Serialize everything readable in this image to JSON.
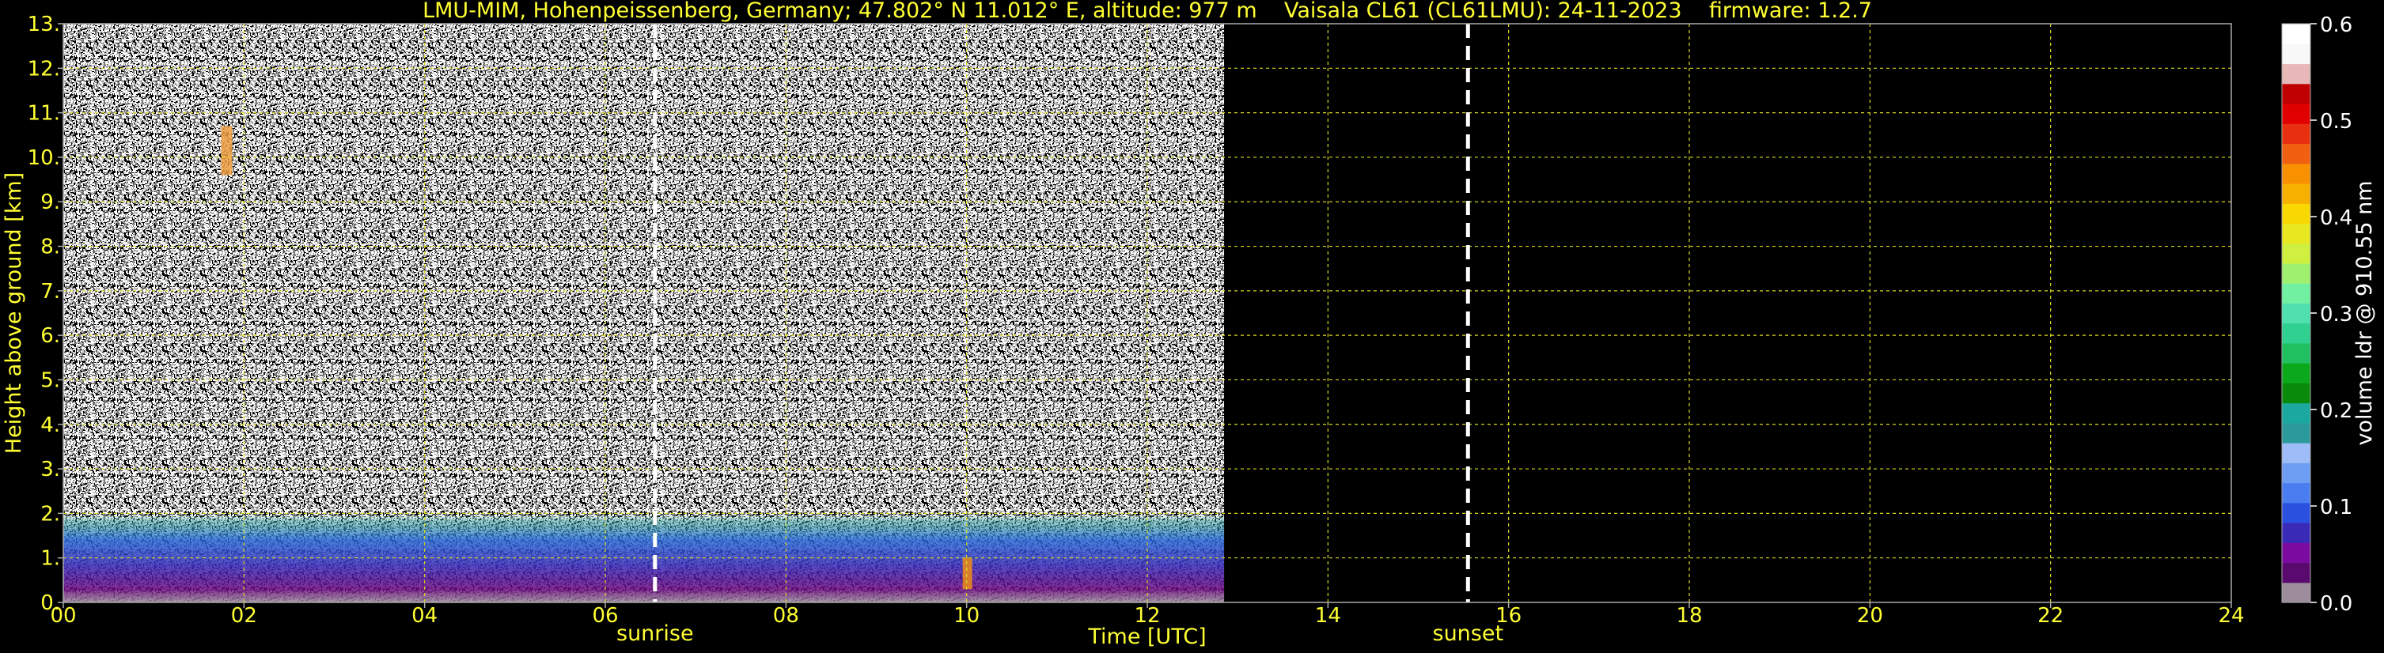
{
  "chart_data": {
    "type": "heatmap",
    "title": "LMU-MIM, Hohenpeissenberg, Germany; 47.802° N 11.012° E, altitude: 977 m    Vaisala CL61 (CL61LMU): 24-11-2023    firmware: 1.2.7",
    "xlabel": "Time [UTC]",
    "ylabel": "Height above ground [km]",
    "xlim": [
      0,
      24
    ],
    "ylim": [
      0,
      13
    ],
    "x_ticks": [
      "00",
      "02",
      "04",
      "06",
      "08",
      "10",
      "12",
      "14",
      "16",
      "18",
      "20",
      "22",
      "24"
    ],
    "x_tick_values": [
      0,
      2,
      4,
      6,
      8,
      10,
      12,
      14,
      16,
      18,
      20,
      22,
      24
    ],
    "y_ticks": [
      "0.",
      "1.",
      "2.",
      "3.",
      "4.",
      "5.",
      "6.",
      "7.",
      "8.",
      "9.",
      "10.",
      "11.",
      "12.",
      "13."
    ],
    "y_tick_values": [
      0,
      1,
      2,
      3,
      4,
      5,
      6,
      7,
      8,
      9,
      10,
      11,
      12,
      13
    ],
    "grid": true,
    "data_end_hour": 12.85,
    "events": [
      {
        "label": "sunrise",
        "x": 6.55
      },
      {
        "label": "sunset",
        "x": 15.55
      }
    ],
    "features": [
      {
        "desc": "aerosol layer",
        "x_start": 0,
        "x_end": 12.85,
        "y_top": 2.0
      },
      {
        "desc": "cirrus",
        "x": 1.8,
        "y_range": [
          9.6,
          10.7
        ]
      },
      {
        "desc": "layer",
        "x": 10.0,
        "y_range": [
          0.3,
          1.0
        ]
      }
    ],
    "colorbar": {
      "label": "volume ldr @ 910.55 nm",
      "range": [
        0.0,
        0.6
      ],
      "ticks": [
        "0.0",
        "0.1",
        "0.2",
        "0.3",
        "0.4",
        "0.5",
        "0.6"
      ],
      "tick_values": [
        0.0,
        0.1,
        0.2,
        0.3,
        0.4,
        0.5,
        0.6
      ],
      "colors": [
        "#9c8c9c",
        "#5a0a6e",
        "#7a0aa0",
        "#3a2ab8",
        "#2a50e0",
        "#4a7ef0",
        "#6e9ef4",
        "#9ebcf8",
        "#2a9a9a",
        "#1aa8a0",
        "#0a8a0a",
        "#0aa81a",
        "#20c060",
        "#30d090",
        "#50e0b0",
        "#70f0a0",
        "#a0f070",
        "#d0f040",
        "#e8e820",
        "#f8d800",
        "#f8b000",
        "#f89000",
        "#f06010",
        "#e83010",
        "#e00000",
        "#c00000",
        "#e8b8b8",
        "#f8f8f8",
        "#ffffff"
      ]
    }
  }
}
